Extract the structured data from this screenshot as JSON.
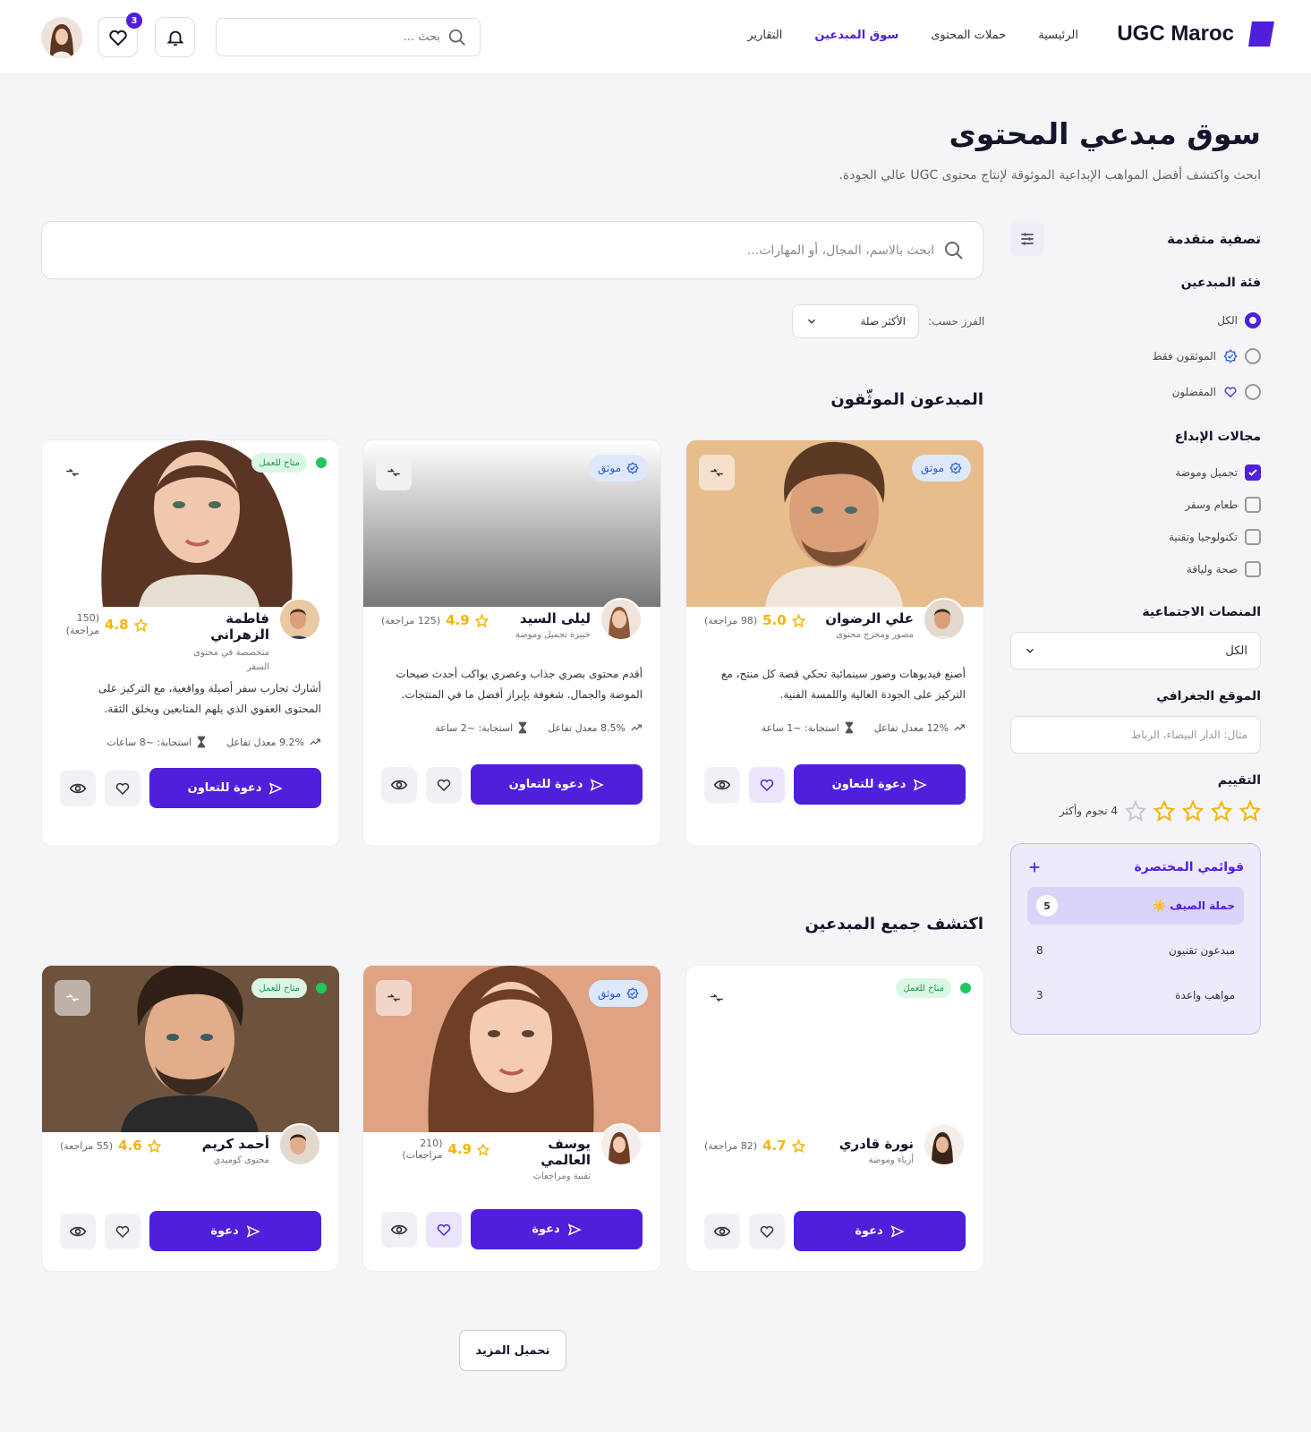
{
  "header": {
    "brand": "UGC Maroc",
    "nav": [
      "الرئيسية",
      "حملات المحتوى",
      "سوق المبدعين",
      "التقارير"
    ],
    "search_placeholder": "بحث ...",
    "favorites_count": "3"
  },
  "page": {
    "title": "سوق مبدعي المحتوى",
    "subtitle": "ابحث واكتشف أفضل المواهب الإبداعية الموثوقة لإنتاج محتوى UGC عالي الجودة."
  },
  "sidebar": {
    "title": "تصفية متقدمة",
    "category_title": "فئة المبدعين",
    "categories": [
      "الكل",
      "الموثقون فقط",
      "المفضلون"
    ],
    "fields_title": "مجالات الإبداع",
    "fields": [
      "تجميل وموضة",
      "طعام وسفر",
      "تكنولوجيا وتقنية",
      "صحة ولياقة"
    ],
    "platforms_title": "المنصات الاجتماعية",
    "platforms_value": "الكل",
    "location_title": "الموقع الجغرافي",
    "location_placeholder": "مثال: الدار البيضاء، الرباط",
    "rating_title": "التقييم",
    "rating_value": 4,
    "rating_label": "4 نجوم وأكثر",
    "lists_title": "قوائمي المختصرة",
    "lists": [
      {
        "name": "حملة الصيف ☀️",
        "count": "5"
      },
      {
        "name": "مبدعون تقنيون",
        "count": "8"
      },
      {
        "name": "مواهب واعدة",
        "count": "3"
      }
    ]
  },
  "main": {
    "search_placeholder": "ابحث بالاسم، المجال، أو المهارات...",
    "sort_label": "الفرز حسب:",
    "sort_value": "الأكثر صلة",
    "verified_title": "المبدعون الموثّقون",
    "all_title": "اكتشف جميع المبدعين",
    "load_more": "تحميل المزيد"
  },
  "labels": {
    "verified": "موثق",
    "available": "متاح للعمل",
    "invite_full": "دعوة للتعاون",
    "invite": "دعوة"
  },
  "colors": {
    "accent": "#4f1fdc",
    "star": "#f5b400",
    "available": "#22c55e"
  },
  "cards": [
    {
      "name": "علي الرضوان",
      "role": "مصور ومخرج محتوى",
      "rating": "5.0",
      "reviews": "(98 مراجعة)",
      "desc": "أصنع فيديوهات وصور سينمائية تحكي قصة كل منتج، مع التركيز على الجودة العالية واللمسة الفنية.",
      "engagement": "12% معدل تفاعل",
      "response": "استجابة: ~1 ساعة"
    },
    {
      "name": "ليلى السيد",
      "role": "خبيرة تجميل وموضة",
      "rating": "4.9",
      "reviews": "(125 مراجعة)",
      "desc": "أقدم محتوى بصري جذاب وعصري يواكب أحدث صيحات الموضة والجمال. شغوفة بإبراز أفضل ما في المنتجات.",
      "engagement": "8.5% معدل تفاعل",
      "response": "استجابة: ~2 ساعة"
    },
    {
      "name": "فاطمة الزهراني",
      "role": "متخصصة في محتوى السفر",
      "rating": "4.8",
      "reviews": "(150 مراجعة)",
      "desc": "أشارك تجارب سفر أصيلة وواقعية، مع التركيز على المحتوى العفوي الذي يلهم المتابعين ويخلق الثقة.",
      "engagement": "9.2% معدل تفاعل",
      "response": "استجابة: ~8 ساعات"
    },
    {
      "name": "نورة قادري",
      "role": "أزياء وموضة",
      "rating": "4.7",
      "reviews": "(82 مراجعة)"
    },
    {
      "name": "يوسف العالمي",
      "role": "تقنية ومراجعات",
      "rating": "4.9",
      "reviews": "(210 مراجعات)"
    },
    {
      "name": "أحمد كريم",
      "role": "محتوى كوميدي",
      "rating": "4.6",
      "reviews": "(55 مراجعة)"
    }
  ]
}
